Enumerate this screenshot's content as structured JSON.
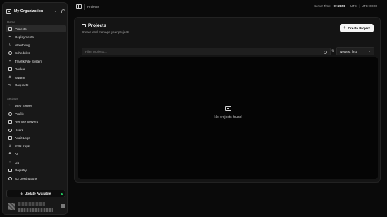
{
  "org": {
    "name": "My Organization"
  },
  "sidebar": {
    "home_label": "Home",
    "settings_label": "Settings",
    "home_items": [
      {
        "label": "Projects",
        "icon": "folder-icon"
      },
      {
        "label": "Deployments",
        "icon": "rocket-icon"
      },
      {
        "label": "Monitoring",
        "icon": "activity-icon"
      },
      {
        "label": "Schedules",
        "icon": "clock-icon"
      },
      {
        "label": "Traefik File System",
        "icon": "git-branch-icon"
      },
      {
        "label": "Docker",
        "icon": "box-icon"
      },
      {
        "label": "Swarm",
        "icon": "network-icon"
      },
      {
        "label": "Requests",
        "icon": "arrow-icon"
      }
    ],
    "settings_items": [
      {
        "label": "Web Server",
        "icon": "server-icon"
      },
      {
        "label": "Profile",
        "icon": "user-icon"
      },
      {
        "label": "Remote Servers",
        "icon": "servers-icon"
      },
      {
        "label": "Users",
        "icon": "users-icon"
      },
      {
        "label": "Audit Logs",
        "icon": "log-icon"
      },
      {
        "label": "SSH Keys",
        "icon": "key-icon"
      },
      {
        "label": "AI",
        "icon": "sparkle-icon"
      },
      {
        "label": "Git",
        "icon": "git-icon"
      },
      {
        "label": "Registry",
        "icon": "package-icon"
      },
      {
        "label": "S3 Destinations",
        "icon": "database-icon"
      }
    ],
    "update_label": "Update Available"
  },
  "topbar": {
    "breadcrumb": "Projects",
    "server_time_label": "Server Time:",
    "server_time": "07:59:59",
    "timezone": "UTC",
    "offset": "UTC+00:00"
  },
  "main": {
    "title": "Projects",
    "subtitle": "Create and manage your projects",
    "create_label": "Create Project",
    "search_placeholder": "Filter projects...",
    "sort_selected": "Newest first",
    "empty_text": "No projects found"
  },
  "colors": {
    "accent_dot": "#22c55e",
    "active_bg": "#2a2a2a"
  }
}
